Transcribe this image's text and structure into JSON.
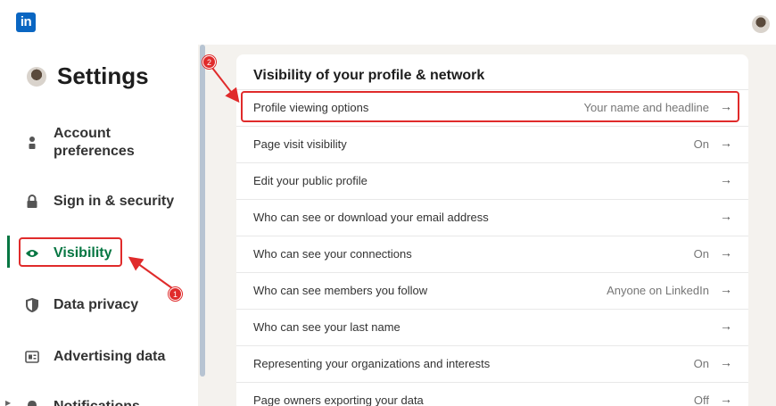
{
  "app": {
    "logo_text": "in"
  },
  "sidebar": {
    "title": "Settings",
    "items": [
      {
        "label": "Account preferences",
        "icon": "person-icon"
      },
      {
        "label": "Sign in & security",
        "icon": "lock-icon"
      },
      {
        "label": "Visibility",
        "icon": "eye-icon",
        "active": true
      },
      {
        "label": "Data privacy",
        "icon": "shield-icon"
      },
      {
        "label": "Advertising data",
        "icon": "ad-icon"
      },
      {
        "label": "Notifications",
        "icon": "bell-icon"
      }
    ]
  },
  "main": {
    "section_title": "Visibility of your profile & network",
    "rows": [
      {
        "label": "Profile viewing options",
        "value": "Your name and headline"
      },
      {
        "label": "Page visit visibility",
        "value": "On"
      },
      {
        "label": "Edit your public profile",
        "value": ""
      },
      {
        "label": "Who can see or download your email address",
        "value": ""
      },
      {
        "label": "Who can see your connections",
        "value": "On"
      },
      {
        "label": "Who can see members you follow",
        "value": "Anyone on LinkedIn"
      },
      {
        "label": "Who can see your last name",
        "value": ""
      },
      {
        "label": "Representing your organizations and interests",
        "value": "On"
      },
      {
        "label": "Page owners exporting your data",
        "value": "Off"
      }
    ],
    "arrow": "→"
  },
  "annotations": {
    "step1": "1",
    "step2": "2",
    "color": "#e02b2b"
  },
  "colors": {
    "brand": "#0a66c2",
    "active": "#057642",
    "background": "#f4f2ee"
  }
}
